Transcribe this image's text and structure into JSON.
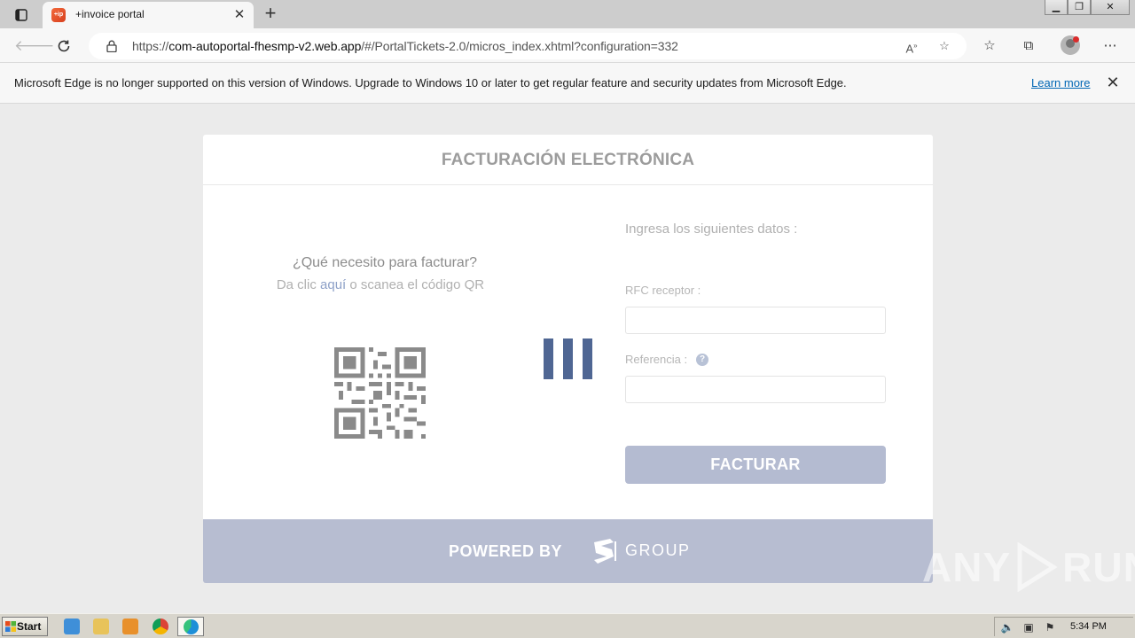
{
  "browser": {
    "tab_title": "+invoice portal",
    "favicon_text": "+ip",
    "new_tab_symbol": "+",
    "url_prefix": "https://",
    "url_host": "com-autoportal-fhesmp-v2.web.app",
    "url_path": "/#/PortalTickets-2.0/micros_index.xhtml?configuration=332"
  },
  "infobar": {
    "message": "Microsoft Edge is no longer supported on this version of Windows. Upgrade to Windows 10 or later to get regular feature and security updates from Microsoft Edge.",
    "link_label": "Learn more"
  },
  "card": {
    "title": "FACTURACIÓN ELECTRÓNICA",
    "question": "¿Qué necesito para facturar?",
    "hint_prefix": "Da clic ",
    "hint_link": "aquí",
    "hint_suffix": " o scanea el código QR",
    "form_title": "Ingresa los siguientes datos :",
    "rfc_label": "RFC receptor :",
    "rfc_value": "",
    "ref_label": "Referencia :",
    "ref_value": "",
    "help_symbol": "?",
    "submit_label": "FACTURAR",
    "footer_powered": "POWERED BY",
    "footer_group": "GROUP"
  },
  "watermark": {
    "left": "ANY",
    "right": "RUN"
  },
  "taskbar": {
    "start_label": "Start",
    "clock": "5:34 PM"
  },
  "colors": {
    "accent_bars": "#4f6693",
    "button": "#b4bbd1",
    "footer": "#b7bdd1",
    "link": "#0066b4"
  }
}
